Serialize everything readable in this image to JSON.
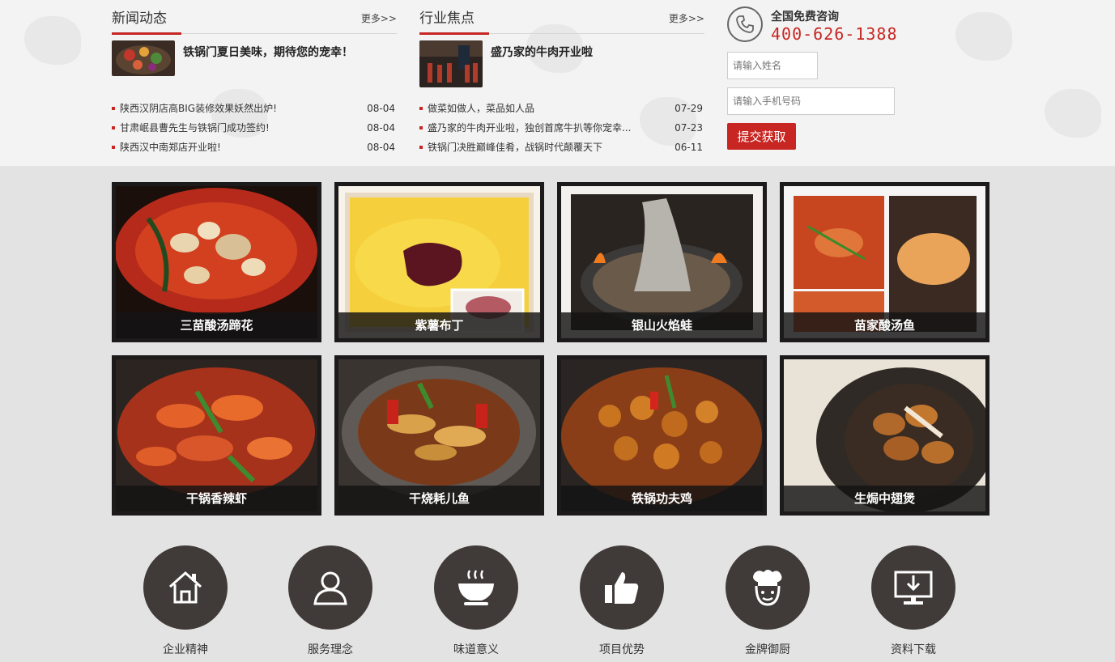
{
  "news": {
    "title": "新闻动态",
    "more": "更多>>",
    "feature_title": "铁锅门夏日美味，期待您的宠幸！",
    "items": [
      {
        "text": "陕西汉阴店高BIG装修效果妖然出炉!",
        "date": "08-04"
      },
      {
        "text": "甘肃岷县曹先生与铁锅门成功签约!",
        "date": "08-04"
      },
      {
        "text": "陕西汉中南郑店开业啦!",
        "date": "08-04"
      }
    ]
  },
  "industry": {
    "title": "行业焦点",
    "more": "更多>>",
    "feature_title": "盛乃家的牛肉开业啦",
    "items": [
      {
        "text": "做菜如做人，菜品如人品",
        "date": "07-29"
      },
      {
        "text": "盛乃家的牛肉开业啦，独创首席牛扒等你宠幸...",
        "date": "07-23"
      },
      {
        "text": "铁锅门决胜巅峰佳肴，战锅时代颠覆天下",
        "date": "06-11"
      }
    ]
  },
  "contact": {
    "label": "全国免费咨询",
    "phone": "400-626-1388",
    "name_placeholder": "请输入姓名",
    "mobile_placeholder": "请输入手机号码",
    "submit_label": "提交获取"
  },
  "dishes": [
    {
      "name": "三苗酸汤蹄花"
    },
    {
      "name": "紫薯布丁"
    },
    {
      "name": "银山火焰蛙"
    },
    {
      "name": "苗家酸汤鱼"
    },
    {
      "name": "干锅香辣虾"
    },
    {
      "name": "干烧耗儿鱼"
    },
    {
      "name": "铁锅功夫鸡"
    },
    {
      "name": "生焗中翅煲"
    }
  ],
  "features": [
    {
      "label": "企业精神",
      "icon": "house-icon"
    },
    {
      "label": "服务理念",
      "icon": "user-icon"
    },
    {
      "label": "味道意义",
      "icon": "bowl-icon"
    },
    {
      "label": "项目优势",
      "icon": "thumbs-up-icon"
    },
    {
      "label": "金牌御厨",
      "icon": "chef-icon"
    },
    {
      "label": "资料下载",
      "icon": "download-monitor-icon"
    }
  ],
  "colors": {
    "accent": "#c72622",
    "icon_bg": "#403b38",
    "band_bg": "#f3f3f3",
    "page_bg": "#e4e3e3"
  }
}
